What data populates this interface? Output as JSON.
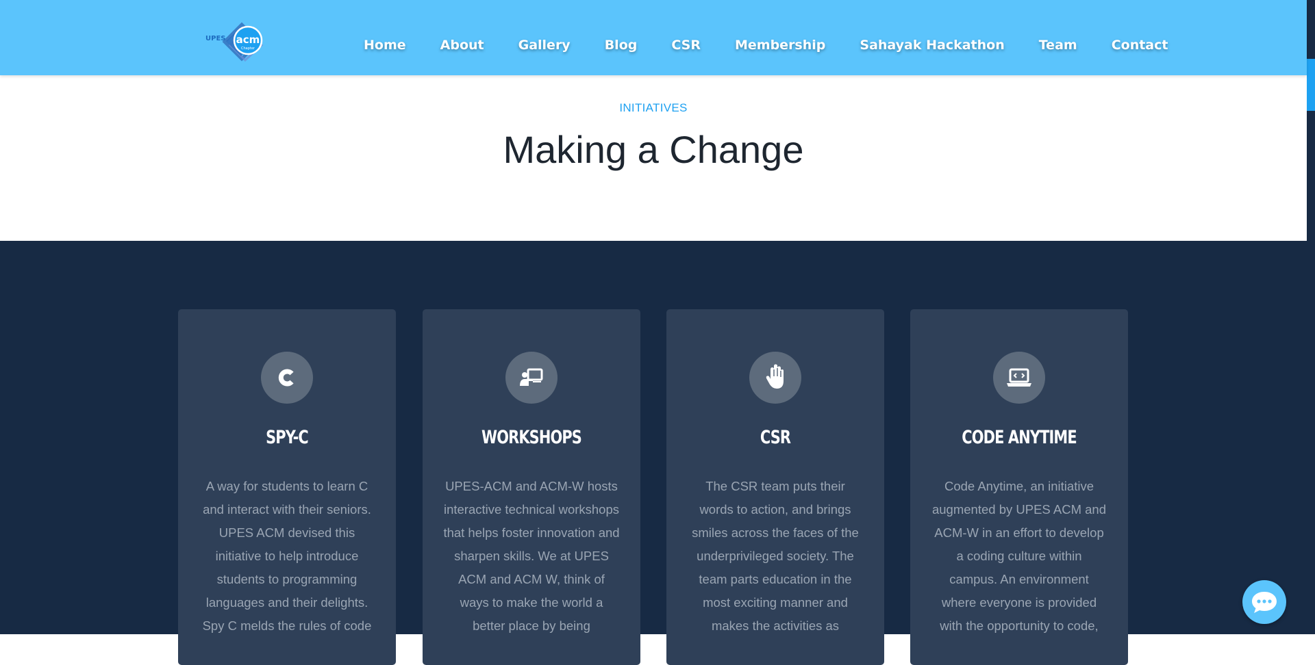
{
  "header": {
    "logo": {
      "text_left": "UPES",
      "text_main": "acm",
      "text_small": "Chapter"
    },
    "nav": [
      {
        "label": "Home"
      },
      {
        "label": "About"
      },
      {
        "label": "Gallery"
      },
      {
        "label": "Blog"
      },
      {
        "label": "CSR"
      },
      {
        "label": "Membership"
      },
      {
        "label": "Sahayak Hackathon"
      },
      {
        "label": "Team"
      },
      {
        "label": "Contact"
      }
    ]
  },
  "intro": {
    "eyebrow": "INITIATIVES",
    "title": "Making a Change"
  },
  "cards": [
    {
      "icon": "c-letter-icon",
      "title": "SPY-C",
      "text": "A way for students to learn C and interact with their seniors. UPES ACM devised this initiative to help introduce students to programming languages and their delights. Spy C melds the rules of code"
    },
    {
      "icon": "presentation-icon",
      "title": "WORKSHOPS",
      "text": "UPES-ACM and ACM-W hosts interactive technical workshops that helps foster innovation and sharpen skills. We at UPES ACM and ACM W, think of ways to make the world a better place by being"
    },
    {
      "icon": "hand-icon",
      "title": "CSR",
      "text": "The CSR team puts their words to action, and brings smiles across the faces of the underprivileged society. The team parts education in the most exciting manner and makes the activities as"
    },
    {
      "icon": "laptop-code-icon",
      "title": "CODE ANYTIME",
      "text": "Code Anytime, an initiative augmented by UPES ACM and ACM-W in an effort to develop a coding culture within campus. An environment where everyone is provided with the opportunity to code,"
    }
  ],
  "chat": {
    "icon": "chat-icon"
  },
  "colors": {
    "header_bg": "#5bc4fc",
    "accent": "#1ea1f1",
    "dark_bg": "#172a44",
    "card_bg": "#2f4058"
  }
}
